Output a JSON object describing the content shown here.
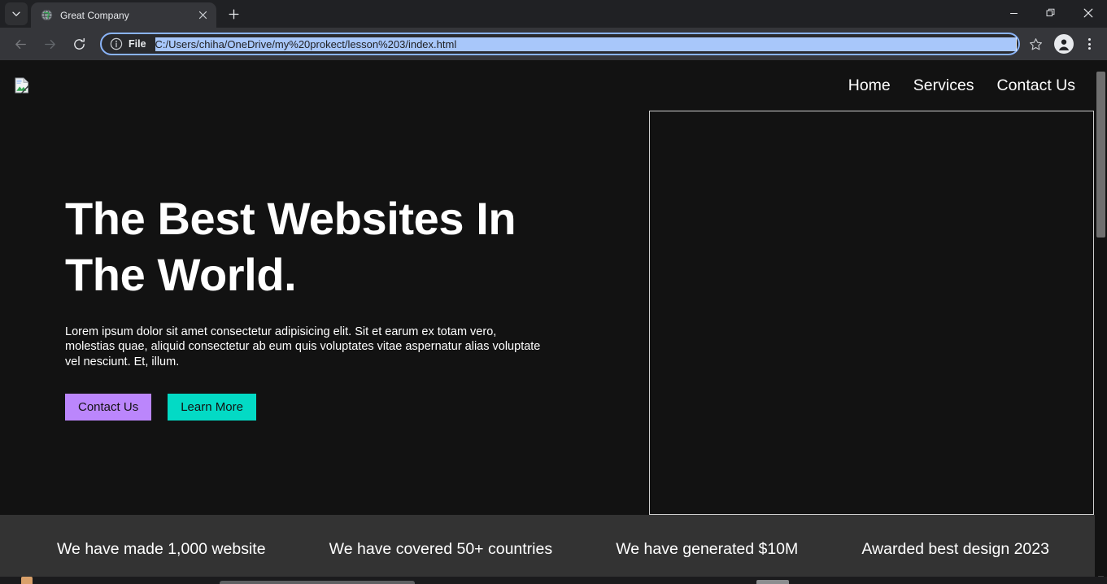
{
  "browser": {
    "tab_search_icon": "chevron-down-icon",
    "tabs": [
      {
        "title": "Great Company",
        "favicon": "globe-icon",
        "close_icon": "close-icon"
      }
    ],
    "new_tab_label": "+",
    "window_controls": {
      "minimize": "minimize-icon",
      "restore": "restore-icon",
      "close": "close-icon"
    },
    "toolbar": {
      "back_icon": "arrow-left-icon",
      "forward_icon": "arrow-right-icon",
      "reload_icon": "reload-icon",
      "site_info_icon": "info-circle-icon",
      "scheme_label": "File",
      "url": "C:/Users/chiha/OneDrive/my%20prokect/lesson%203/index.html",
      "bookmark_icon": "star-icon",
      "profile_icon": "avatar-icon",
      "menu_icon": "kebab-menu-icon"
    }
  },
  "page": {
    "logo": {
      "icon": "broken-image-icon",
      "alt": ""
    },
    "nav": [
      {
        "label": "Home"
      },
      {
        "label": "Services"
      },
      {
        "label": "Contact Us"
      }
    ],
    "hero": {
      "title": "The Best Websites In The World.",
      "subtitle": "Lorem ipsum dolor sit amet consectetur adipisicing elit. Sit et earum ex totam vero, molestias quae, aliquid consectetur ab eum quis voluptates vitae aspernatur alias voluptate vel nesciunt. Et, illum.",
      "buttons": [
        {
          "label": "Contact Us",
          "color": "#bb86fc"
        },
        {
          "label": "Learn More",
          "color": "#03dac5"
        }
      ],
      "media_placeholder_border": "#cfcfcf"
    },
    "stats": [
      {
        "label": "We have made 1,000 website"
      },
      {
        "label": "We have covered 50+ countries"
      },
      {
        "label": "We have generated $10M"
      },
      {
        "label": "Awarded best design 2023"
      }
    ],
    "colors": {
      "background": "#121212",
      "stats_background": "#333333",
      "text": "#ffffff"
    }
  }
}
